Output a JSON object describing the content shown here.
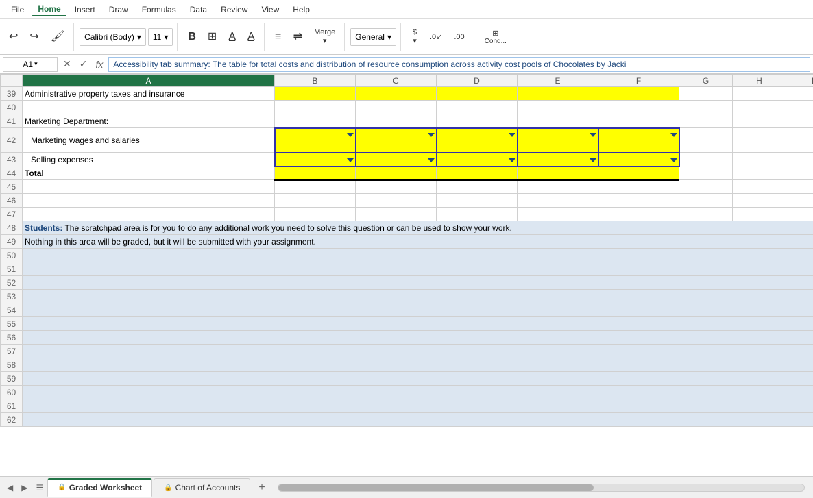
{
  "menu": {
    "items": [
      "File",
      "Home",
      "Insert",
      "Draw",
      "Formulas",
      "Data",
      "Review",
      "View",
      "Help"
    ],
    "active": "Home"
  },
  "ribbon": {
    "font_family": "Calibri (Body)",
    "font_size": "11",
    "number_format": "General",
    "bold_label": "B",
    "merge_label": "Merge",
    "merge_arrow": "▾"
  },
  "formula_bar": {
    "cell_ref": "A1",
    "formula_text": "Accessibility tab summary: The table for total costs and distribution of resource consumption across activity cost pools of Chocolates by Jacki"
  },
  "columns": [
    "",
    "A",
    "B",
    "C",
    "D",
    "E",
    "F",
    "G",
    "H",
    "I"
  ],
  "rows": [
    {
      "num": "39",
      "A": "Administrative property taxes and insurance",
      "B": "",
      "C": "",
      "D": "",
      "E": "",
      "F": "",
      "G": "",
      "H": "",
      "I": "",
      "rowClass": "yellow-row"
    },
    {
      "num": "40",
      "A": "",
      "B": "",
      "C": "",
      "D": "",
      "E": "",
      "F": "",
      "G": "",
      "H": "",
      "I": "",
      "rowClass": ""
    },
    {
      "num": "41",
      "A": "Marketing Department:",
      "B": "",
      "C": "",
      "D": "",
      "E": "",
      "F": "",
      "G": "",
      "H": "",
      "I": "",
      "rowClass": ""
    },
    {
      "num": "42",
      "A": "  Marketing wages and salaries",
      "B": "▾",
      "C": "▾",
      "D": "▾",
      "E": "▾",
      "F": "▾",
      "G": "",
      "H": "",
      "I": "",
      "rowClass": "yellow-row tall"
    },
    {
      "num": "43",
      "A": "  Selling expenses",
      "B": "▾",
      "C": "▾",
      "D": "▾",
      "E": "▾",
      "F": "▾",
      "G": "",
      "H": "",
      "I": "",
      "rowClass": "yellow-row"
    },
    {
      "num": "44",
      "A": "Total",
      "B": "",
      "C": "",
      "D": "",
      "E": "",
      "F": "",
      "G": "",
      "H": "",
      "I": "",
      "rowClass": "yellow-row bold"
    },
    {
      "num": "45",
      "A": "",
      "B": "",
      "C": "",
      "D": "",
      "E": "",
      "F": "",
      "G": "",
      "H": "",
      "I": "",
      "rowClass": ""
    },
    {
      "num": "46",
      "A": "",
      "B": "",
      "C": "",
      "D": "",
      "E": "",
      "F": "",
      "G": "",
      "H": "",
      "I": "",
      "rowClass": ""
    },
    {
      "num": "47",
      "A": "",
      "B": "",
      "C": "",
      "D": "",
      "E": "",
      "F": "",
      "G": "",
      "H": "",
      "I": "",
      "rowClass": ""
    },
    {
      "num": "48",
      "A": "Students: The scratchpad area is for you to do any additional work you need to solve this question or can be used to show your work.",
      "B": "",
      "C": "",
      "D": "",
      "E": "",
      "F": "",
      "G": "",
      "H": "",
      "I": "",
      "rowClass": "light-blue-row"
    },
    {
      "num": "49",
      "A": "Nothing in this area will be graded, but it will be submitted with your assignment.",
      "B": "",
      "C": "",
      "D": "",
      "E": "",
      "F": "",
      "G": "",
      "H": "",
      "I": "",
      "rowClass": "light-blue-row"
    },
    {
      "num": "50",
      "A": "",
      "B": "",
      "C": "",
      "D": "",
      "E": "",
      "F": "",
      "G": "",
      "H": "",
      "I": "",
      "rowClass": "light-blue-row"
    },
    {
      "num": "51",
      "A": "",
      "B": "",
      "C": "",
      "D": "",
      "E": "",
      "F": "",
      "G": "",
      "H": "",
      "I": "",
      "rowClass": "light-blue-row"
    },
    {
      "num": "52",
      "A": "",
      "B": "",
      "C": "",
      "D": "",
      "E": "",
      "F": "",
      "G": "",
      "H": "",
      "I": "",
      "rowClass": "light-blue-row"
    },
    {
      "num": "53",
      "A": "",
      "B": "",
      "C": "",
      "D": "",
      "E": "",
      "F": "",
      "G": "",
      "H": "",
      "I": "",
      "rowClass": "light-blue-row"
    },
    {
      "num": "54",
      "A": "",
      "B": "",
      "C": "",
      "D": "",
      "E": "",
      "F": "",
      "G": "",
      "H": "",
      "I": "",
      "rowClass": "light-blue-row"
    },
    {
      "num": "55",
      "A": "",
      "B": "",
      "C": "",
      "D": "",
      "E": "",
      "F": "",
      "G": "",
      "H": "",
      "I": "",
      "rowClass": "light-blue-row"
    },
    {
      "num": "56",
      "A": "",
      "B": "",
      "C": "",
      "D": "",
      "E": "",
      "F": "",
      "G": "",
      "H": "",
      "I": "",
      "rowClass": "light-blue-row"
    },
    {
      "num": "57",
      "A": "",
      "B": "",
      "C": "",
      "D": "",
      "E": "",
      "F": "",
      "G": "",
      "H": "",
      "I": "",
      "rowClass": "light-blue-row"
    },
    {
      "num": "58",
      "A": "",
      "B": "",
      "C": "",
      "D": "",
      "E": "",
      "F": "",
      "G": "",
      "H": "",
      "I": "",
      "rowClass": "light-blue-row"
    },
    {
      "num": "59",
      "A": "",
      "B": "",
      "C": "",
      "D": "",
      "E": "",
      "F": "",
      "G": "",
      "H": "",
      "I": "",
      "rowClass": "light-blue-row"
    },
    {
      "num": "60",
      "A": "",
      "B": "",
      "C": "",
      "D": "",
      "E": "",
      "F": "",
      "G": "",
      "H": "",
      "I": "",
      "rowClass": "light-blue-row"
    },
    {
      "num": "61",
      "A": "",
      "B": "",
      "C": "",
      "D": "",
      "E": "",
      "F": "",
      "G": "",
      "H": "",
      "I": "",
      "rowClass": "light-blue-row"
    },
    {
      "num": "62",
      "A": "",
      "B": "",
      "C": "",
      "D": "",
      "E": "",
      "F": "",
      "G": "",
      "H": "",
      "I": "",
      "rowClass": "light-blue-row"
    }
  ],
  "row48_students_label": "Students:",
  "row48_rest": " The scratchpad area is for you to do any additional work you need to solve this question or can be used to show your work.",
  "row49_text": "Nothing in this area will be graded, but it will be submitted with your assignment.",
  "tabs": [
    {
      "label": "Graded Worksheet",
      "active": true,
      "lock": true
    },
    {
      "label": "Chart of Accounts",
      "active": false,
      "lock": true
    }
  ],
  "tab_add_label": "+",
  "colors": {
    "yellow": "#ffff00",
    "light_blue": "#dce6f1",
    "green_accent": "#217346",
    "triangle": "#1f497d",
    "students_label": "#1f497d"
  }
}
